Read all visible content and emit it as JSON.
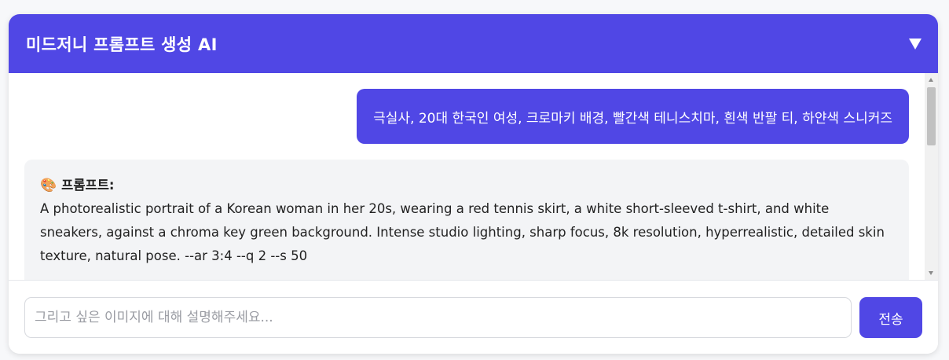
{
  "header": {
    "title": "미드저니 프롬프트 생성 AI",
    "toggle_icon": "chevron-down-icon"
  },
  "chat": {
    "messages": [
      {
        "role": "user",
        "text": "극실사, 20대 한국인 여성, 크로마키 배경, 빨간색 테니스치마, 흰색 반팔 티, 하얀색 스니커즈"
      },
      {
        "role": "assistant",
        "icon": "🎨",
        "label": "프롬프트:",
        "text": "A photorealistic portrait of a Korean woman in her 20s, wearing a red tennis skirt, a white short-sleeved t-shirt, and white sneakers, against a chroma key green background. Intense studio lighting, sharp focus, 8k resolution, hyperrealistic, detailed skin texture, natural pose. --ar 3:4 --q 2 --s 50"
      }
    ]
  },
  "input": {
    "placeholder": "그리고 싶은 이미지에 대해 설명해주세요...",
    "value": "",
    "send_label": "전송"
  },
  "colors": {
    "accent": "#5047e5",
    "bot_bubble": "#f3f4f6"
  }
}
